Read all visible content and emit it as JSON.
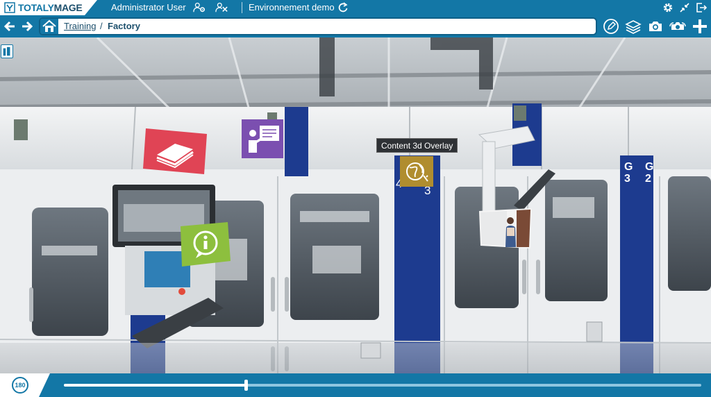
{
  "header": {
    "logo_part1": "TOTALY",
    "logo_part2": "MAGE",
    "user_name": "Administrator User",
    "environment": "Environnement demo"
  },
  "breadcrumb": {
    "link": "Training",
    "separator": "/",
    "current": "Factory"
  },
  "scene": {
    "tooltip": "Content 3d Overlay",
    "labels": {
      "g3": "G 3",
      "g2": "G 2",
      "n4": "4",
      "n3": "3"
    },
    "hotspots": [
      {
        "name": "book",
        "icon": "book-icon",
        "color": "#e04455"
      },
      {
        "name": "presentation",
        "icon": "presentation-icon",
        "color": "#7b4fb0"
      },
      {
        "name": "content-3d-overlay",
        "icon": "globe-icon",
        "color": "#b08d2f"
      },
      {
        "name": "info",
        "icon": "info-icon",
        "color": "#8dbf3e"
      },
      {
        "name": "photo",
        "icon": "photo-thumbnail",
        "color": "#ffffff"
      }
    ]
  },
  "player": {
    "view_mode": "180",
    "progress": 0.285
  },
  "colors": {
    "brand": "#1377a6",
    "brand_dark": "#1c4f6c"
  }
}
